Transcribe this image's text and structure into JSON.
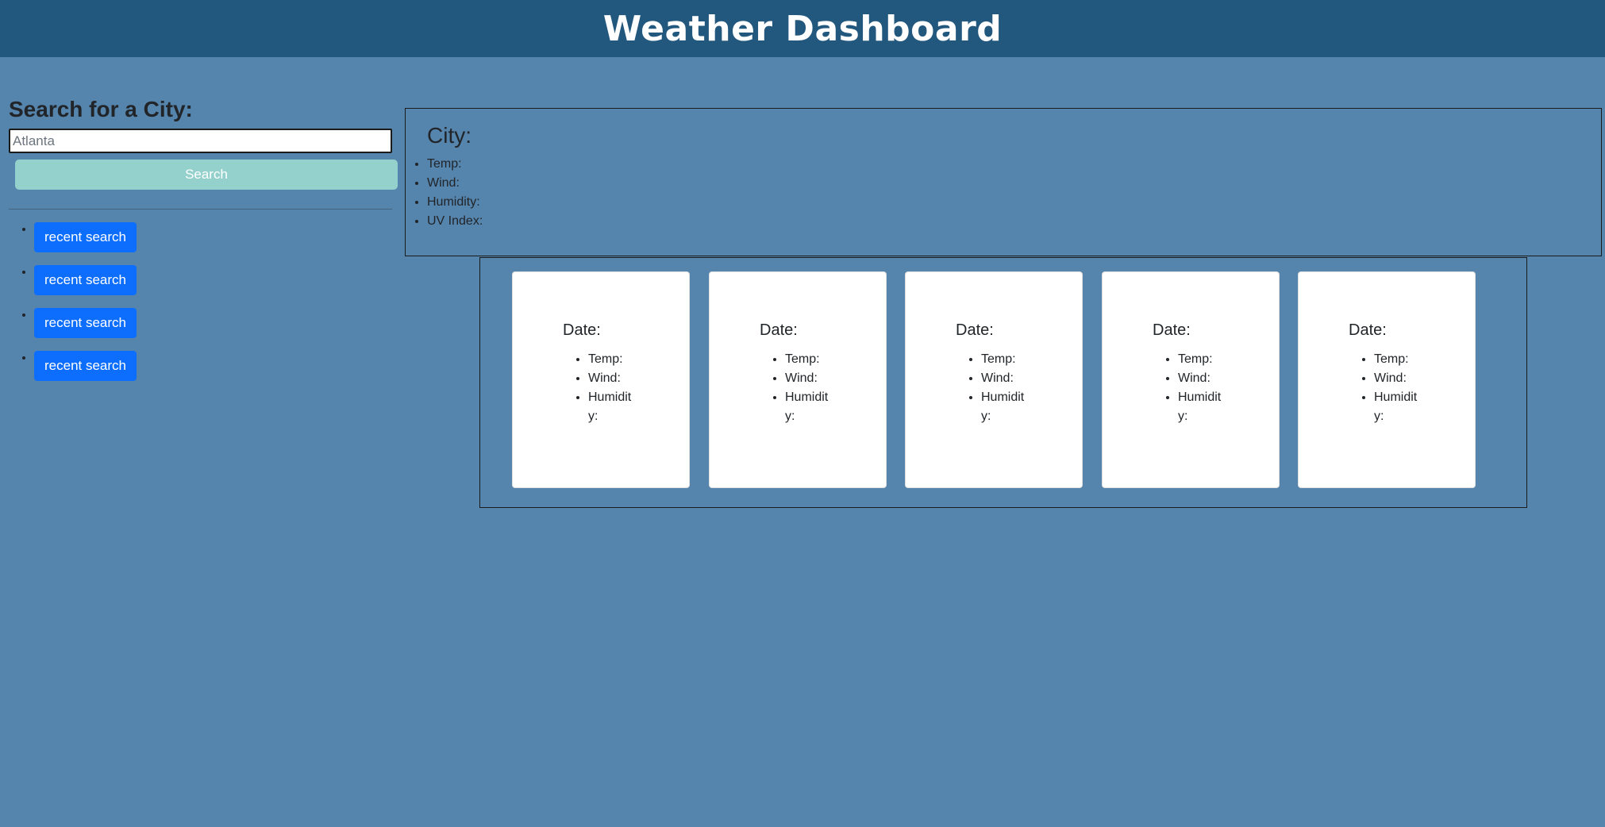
{
  "header": {
    "title": "Weather Dashboard"
  },
  "search": {
    "heading": "Search for a City:",
    "input_value": "",
    "placeholder": "Atlanta",
    "button_label": "Search"
  },
  "recent": {
    "items": [
      {
        "label": "recent search"
      },
      {
        "label": "recent search"
      },
      {
        "label": "recent search"
      },
      {
        "label": "recent search"
      }
    ]
  },
  "current": {
    "title": "City:",
    "fields": [
      "Temp:",
      "Wind:",
      "Humidity:",
      "UV Index:"
    ]
  },
  "forecast": {
    "cards": [
      {
        "date": "Date:",
        "fields": [
          "Temp:",
          "Wind:",
          "Humidity:"
        ]
      },
      {
        "date": "Date:",
        "fields": [
          "Temp:",
          "Wind:",
          "Humidity:"
        ]
      },
      {
        "date": "Date:",
        "fields": [
          "Temp:",
          "Wind:",
          "Humidity:"
        ]
      },
      {
        "date": "Date:",
        "fields": [
          "Temp:",
          "Wind:",
          "Humidity:"
        ]
      },
      {
        "date": "Date:",
        "fields": [
          "Temp:",
          "Wind:",
          "Humidity:"
        ]
      }
    ]
  },
  "colors": {
    "header_bg": "#22577e",
    "page_bg": "#5584ac",
    "search_button": "#95d1cc",
    "recent_button": "#0d6efd"
  }
}
